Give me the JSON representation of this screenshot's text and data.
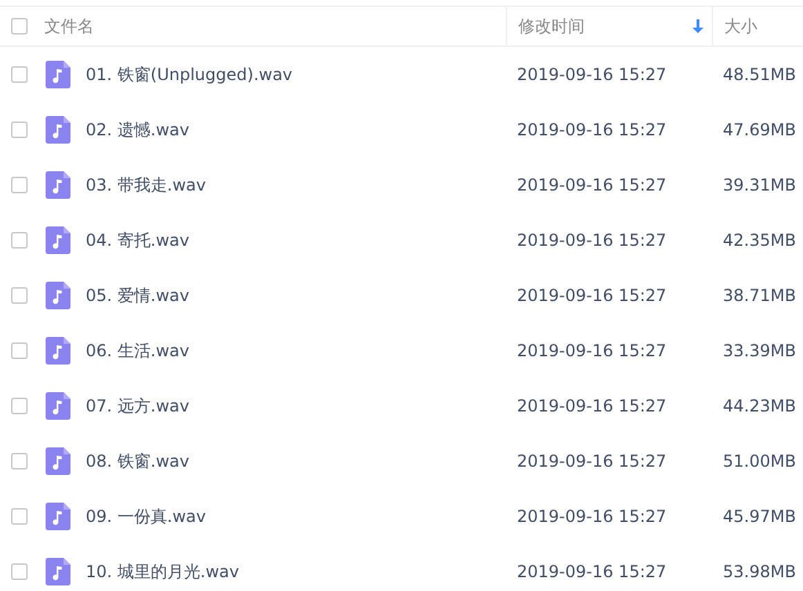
{
  "table": {
    "select_all": {
      "checked": false
    },
    "columns": [
      {
        "label": "文件名",
        "sorted": false
      },
      {
        "label": "修改时间",
        "sorted": true
      },
      {
        "label": "大小",
        "sorted": false
      }
    ],
    "rows": [
      {
        "checked": false,
        "name": "01. 铁窗(Unplugged).wav",
        "modified": "2019-09-16 15:27",
        "size": "48.51MB"
      },
      {
        "checked": false,
        "name": "02. 遗憾.wav",
        "modified": "2019-09-16 15:27",
        "size": "47.69MB"
      },
      {
        "checked": false,
        "name": "03. 带我走.wav",
        "modified": "2019-09-16 15:27",
        "size": "39.31MB"
      },
      {
        "checked": false,
        "name": "04. 寄托.wav",
        "modified": "2019-09-16 15:27",
        "size": "42.35MB"
      },
      {
        "checked": false,
        "name": "05. 爱情.wav",
        "modified": "2019-09-16 15:27",
        "size": "38.71MB"
      },
      {
        "checked": false,
        "name": "06. 生活.wav",
        "modified": "2019-09-16 15:27",
        "size": "33.39MB"
      },
      {
        "checked": false,
        "name": "07. 远方.wav",
        "modified": "2019-09-16 15:27",
        "size": "44.23MB"
      },
      {
        "checked": false,
        "name": "08. 铁窗.wav",
        "modified": "2019-09-16 15:27",
        "size": "51.00MB"
      },
      {
        "checked": false,
        "name": "09. 一份真.wav",
        "modified": "2019-09-16 15:27",
        "size": "45.97MB"
      },
      {
        "checked": false,
        "name": "10. 城里的月光.wav",
        "modified": "2019-09-16 15:27",
        "size": "53.98MB"
      }
    ]
  }
}
